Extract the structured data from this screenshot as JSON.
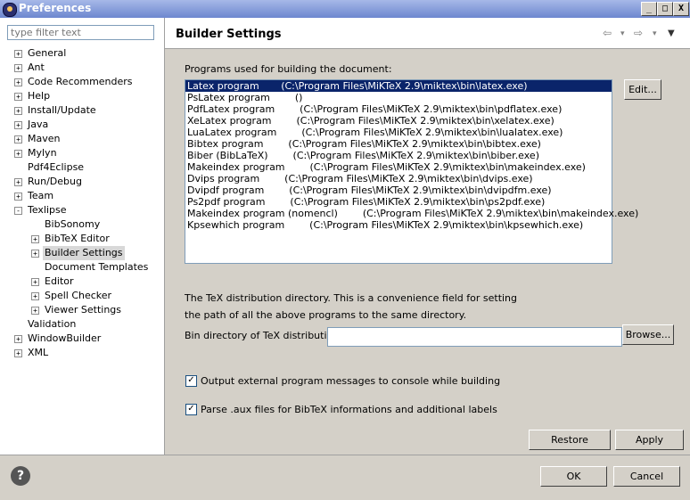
{
  "window": {
    "title": "Preferences",
    "min_label": "_",
    "max_label": "□",
    "close_label": "X"
  },
  "filter": {
    "placeholder": "type filter text"
  },
  "tree": [
    {
      "label": "General",
      "expander": "+",
      "indent": 0
    },
    {
      "label": "Ant",
      "expander": "+",
      "indent": 0
    },
    {
      "label": "Code Recommenders",
      "expander": "+",
      "indent": 0
    },
    {
      "label": "Help",
      "expander": "+",
      "indent": 0
    },
    {
      "label": "Install/Update",
      "expander": "+",
      "indent": 0
    },
    {
      "label": "Java",
      "expander": "+",
      "indent": 0
    },
    {
      "label": "Maven",
      "expander": "+",
      "indent": 0
    },
    {
      "label": "Mylyn",
      "expander": "+",
      "indent": 0
    },
    {
      "label": "Pdf4Eclipse",
      "expander": "",
      "indent": 0
    },
    {
      "label": "Run/Debug",
      "expander": "+",
      "indent": 0
    },
    {
      "label": "Team",
      "expander": "+",
      "indent": 0
    },
    {
      "label": "Texlipse",
      "expander": "-",
      "indent": 0
    },
    {
      "label": "BibSonomy",
      "expander": "",
      "indent": 1
    },
    {
      "label": "BibTeX Editor",
      "expander": "+",
      "indent": 1
    },
    {
      "label": "Builder Settings",
      "expander": "+",
      "indent": 1,
      "selected": true
    },
    {
      "label": "Document Templates",
      "expander": "",
      "indent": 1
    },
    {
      "label": "Editor",
      "expander": "+",
      "indent": 1
    },
    {
      "label": "Spell Checker",
      "expander": "+",
      "indent": 1
    },
    {
      "label": "Viewer Settings",
      "expander": "+",
      "indent": 1
    },
    {
      "label": "Validation",
      "expander": "",
      "indent": 0
    },
    {
      "label": "WindowBuilder",
      "expander": "+",
      "indent": 0
    },
    {
      "label": "XML",
      "expander": "+",
      "indent": 0
    }
  ],
  "page": {
    "title": "Builder Settings",
    "nav": {
      "back": "⇦",
      "back_menu": "▾",
      "fwd": "⇨",
      "fwd_menu": "▾",
      "menu": "▼"
    },
    "programs_label": "Programs used for building the document:",
    "programs": [
      "Latex program       (C:\\Program Files\\MiKTeX 2.9\\miktex\\bin\\latex.exe)",
      "PsLatex program        ()",
      "PdfLatex program        (C:\\Program Files\\MiKTeX 2.9\\miktex\\bin\\pdflatex.exe)",
      "XeLatex program        (C:\\Program Files\\MiKTeX 2.9\\miktex\\bin\\xelatex.exe)",
      "LuaLatex program        (C:\\Program Files\\MiKTeX 2.9\\miktex\\bin\\lualatex.exe)",
      "Bibtex program        (C:\\Program Files\\MiKTeX 2.9\\miktex\\bin\\bibtex.exe)",
      "Biber (BibLaTeX)        (C:\\Program Files\\MiKTeX 2.9\\miktex\\bin\\biber.exe)",
      "Makeindex program        (C:\\Program Files\\MiKTeX 2.9\\miktex\\bin\\makeindex.exe)",
      "Dvips program        (C:\\Program Files\\MiKTeX 2.9\\miktex\\bin\\dvips.exe)",
      "Dvipdf program        (C:\\Program Files\\MiKTeX 2.9\\miktex\\bin\\dvipdfm.exe)",
      "Ps2pdf program        (C:\\Program Files\\MiKTeX 2.9\\miktex\\bin\\ps2pdf.exe)",
      "Makeindex program (nomencl)        (C:\\Program Files\\MiKTeX 2.9\\miktex\\bin\\makeindex.exe)",
      "Kpsewhich program        (C:\\Program Files\\MiKTeX 2.9\\miktex\\bin\\kpsewhich.exe)"
    ],
    "edit_label": "Edit...",
    "texdir_text1": "The TeX distribution directory. This is a convenience field for setting",
    "texdir_text2": "the path of all the above programs to the same directory.",
    "bin_label": "Bin directory of TeX distribution:",
    "bin_value": "",
    "browse_label": "Browse...",
    "check1": "Output external program messages to console while building",
    "check2": "Parse .aux files for BibTeX informations and additional labels",
    "restore_label": "Restore Defaults",
    "apply_label": "Apply"
  },
  "footer": {
    "help": "?",
    "ok": "OK",
    "cancel": "Cancel"
  }
}
